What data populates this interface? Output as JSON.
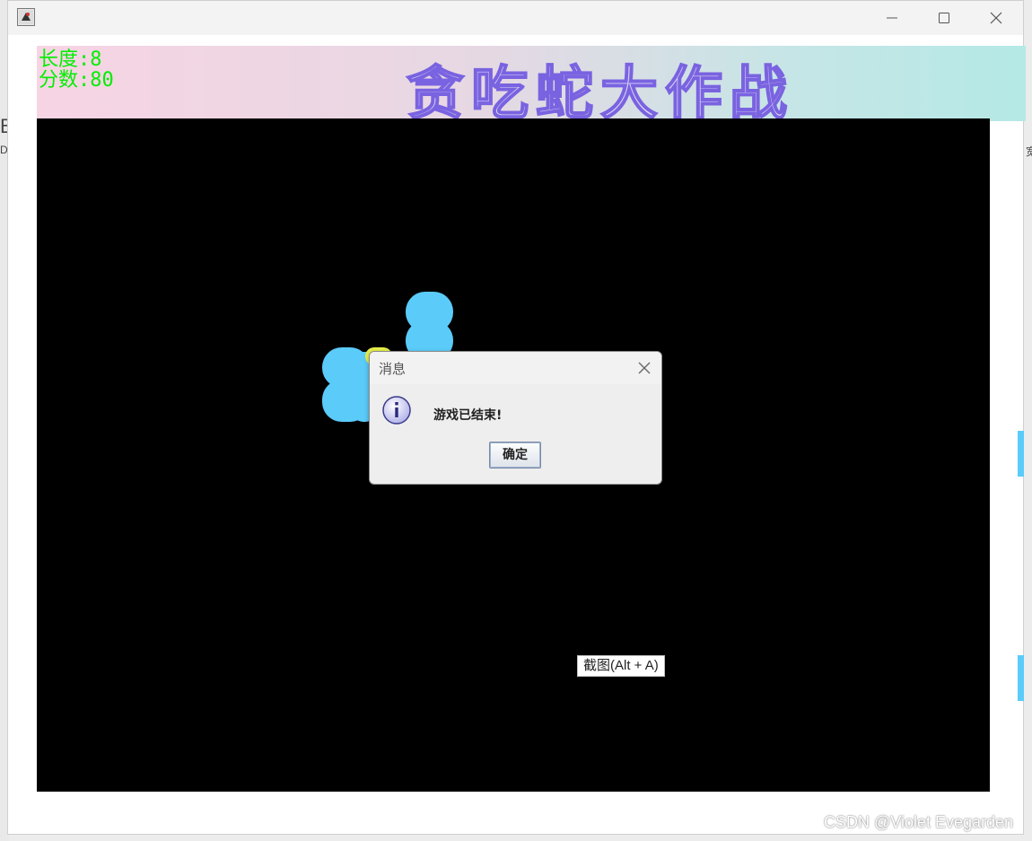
{
  "hud": {
    "length_label": "长度:8",
    "score_label": "分数:80"
  },
  "game": {
    "title": "贪吃蛇大作战",
    "snake_length": 8,
    "score": 80,
    "snake_color": "#5bcbfa",
    "food_color": "#e8f04a",
    "board_color": "#000000",
    "hud_color": "#00ee00",
    "title_outline_color": "#7a63e0"
  },
  "dialog": {
    "title": "消息",
    "message": "游戏已结束!",
    "ok_label": "确定",
    "icon": "info-icon"
  },
  "tooltip": {
    "text": "截图(Alt + A)"
  },
  "window": {
    "controls": [
      "minimize-icon",
      "maximize-icon",
      "close-icon"
    ]
  },
  "background": {
    "fragment_b": "B",
    "fragment_k": "D",
    "fragment_r": "宽"
  },
  "watermark": {
    "text": "CSDN @Violet Evegarden"
  }
}
